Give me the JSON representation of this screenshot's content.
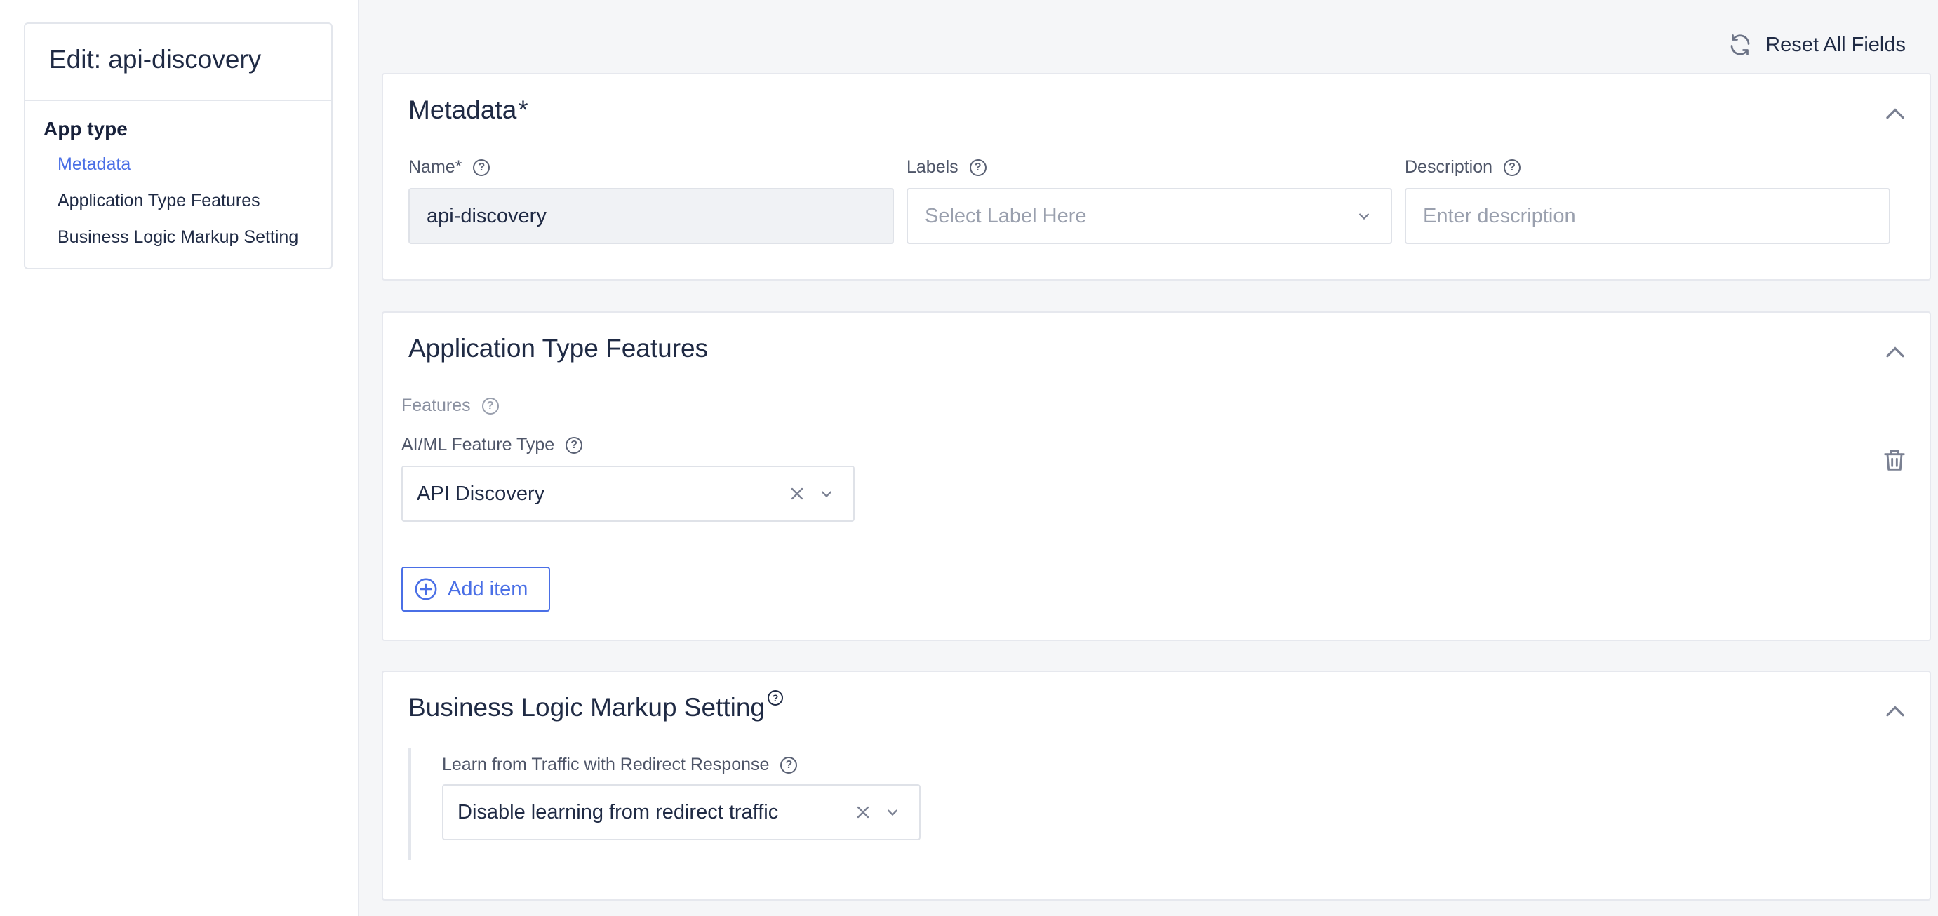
{
  "sidebar": {
    "title": "Edit: api-discovery",
    "group": "App type",
    "items": [
      {
        "label": "Metadata",
        "active": true
      },
      {
        "label": "Application Type Features",
        "active": false
      },
      {
        "label": "Business Logic Markup Setting",
        "active": false
      }
    ]
  },
  "toolbar": {
    "reset_label": "Reset All Fields"
  },
  "metadata": {
    "title": "Metadata",
    "required_mark": "*",
    "name": {
      "label": "Name*",
      "value": "api-discovery"
    },
    "labels": {
      "label": "Labels",
      "placeholder": "Select Label Here"
    },
    "description": {
      "label": "Description",
      "placeholder": "Enter description"
    }
  },
  "features": {
    "title": "Application Type Features",
    "features_label": "Features",
    "type_label": "AI/ML Feature Type",
    "type_value": "API Discovery",
    "add_label": "Add item"
  },
  "business_logic": {
    "title": "Business Logic Markup Setting",
    "redirect_label": "Learn from Traffic with Redirect Response",
    "redirect_value": "Disable learning from redirect traffic"
  },
  "colors": {
    "accent": "#4a6fe6",
    "text": "#1f2a44",
    "muted": "#9aa0ae",
    "border": "#e3e6ec",
    "background": "#f5f6f8"
  },
  "icons": {
    "reset": "refresh-icon",
    "collapse": "chevron-up-icon",
    "dropdown": "chevron-down-icon",
    "clear": "close-icon",
    "help": "help-icon",
    "delete": "trash-icon",
    "add": "plus-circle-icon"
  }
}
